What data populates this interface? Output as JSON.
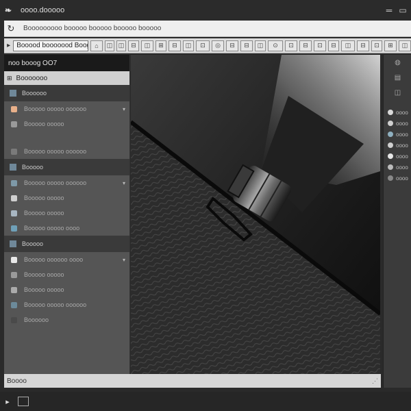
{
  "window": {
    "title": "oooo.dooooo",
    "app_icon": "app-icon",
    "controls": [
      "minimize",
      "maximize"
    ]
  },
  "address": {
    "back_icon": "refresh-icon",
    "text": "Booooooooo booooo booooo    booooo booooo"
  },
  "toolbar": {
    "search_value": "Booood booooood Boogo",
    "buttons": [
      "⌂",
      "◫",
      "◫",
      "⊟",
      "◫",
      "⊞",
      "⊟",
      "◫",
      "⊡",
      "◎",
      "⊟",
      "⊟",
      "◫",
      "⊙",
      "⊡",
      "⊟",
      "⊡",
      "⊟",
      "◫",
      "⊟",
      "⊡",
      "⊞",
      "◫"
    ]
  },
  "left_panel": {
    "header": "noo booog OO7",
    "search_label": "Booooooo",
    "groups": [
      {
        "section": "Boooooo",
        "items": [
          {
            "label": "Booooo ooooo oooooo",
            "icon_color": "#e8b08a",
            "chevron": true
          },
          {
            "label": "Booooo ooooo",
            "icon_color": "#9a9a9a",
            "chevron": false
          },
          {
            "label": "",
            "icon_color": "",
            "chevron": false
          },
          {
            "label": "Booooo ooooo oooooo",
            "icon_color": "#7a7a7a",
            "chevron": false
          }
        ]
      },
      {
        "section": "Booooo",
        "items": [
          {
            "label": "Booooo ooooo oooooo",
            "icon_color": "#7e99a8",
            "chevron": true
          },
          {
            "label": "Booooo ooooo",
            "icon_color": "#cfcfcf",
            "chevron": false
          },
          {
            "label": "Booooo ooooo",
            "icon_color": "#a8b6c2",
            "chevron": false
          },
          {
            "label": "Booooo ooooo oooo",
            "icon_color": "#6fa0b8",
            "chevron": false
          }
        ]
      },
      {
        "section": "Booooo",
        "items": [
          {
            "label": "Booooo oooooo oooo",
            "icon_color": "#e8e8e8",
            "chevron": true
          },
          {
            "label": "Booooo ooooo",
            "icon_color": "#9a9a9a",
            "chevron": false
          },
          {
            "label": "Booooo ooooo",
            "icon_color": "#aaaaaa",
            "chevron": false
          },
          {
            "label": "Booooo ooooo oooooo",
            "icon_color": "#6c8a9a",
            "chevron": false
          },
          {
            "label": "Boooooo",
            "icon_color": "#4a4a4a",
            "chevron": false
          }
        ]
      }
    ]
  },
  "right_panel": {
    "buttons": [
      "◍",
      "▤",
      "◫"
    ],
    "rows": [
      {
        "label": "oooo",
        "dot_color": "#d9d9d9"
      },
      {
        "label": "oooo",
        "dot_color": "#cfcfcf"
      },
      {
        "label": "oooo",
        "dot_color": "#8fb0c0"
      },
      {
        "label": "oooo",
        "dot_color": "#cfcfcf"
      },
      {
        "label": "oooo",
        "dot_color": "#e6e6e6"
      },
      {
        "label": "oooo",
        "dot_color": "#bbbbbb"
      },
      {
        "label": "oooo",
        "dot_color": "#888888"
      }
    ]
  },
  "status": {
    "text": "Boooo"
  },
  "bottom": {
    "left_icon": "logo-icon"
  },
  "colors": {
    "chrome_dark": "#2b2b2b",
    "panel_gray": "#555555",
    "accent_blue": "#7e99a8"
  }
}
